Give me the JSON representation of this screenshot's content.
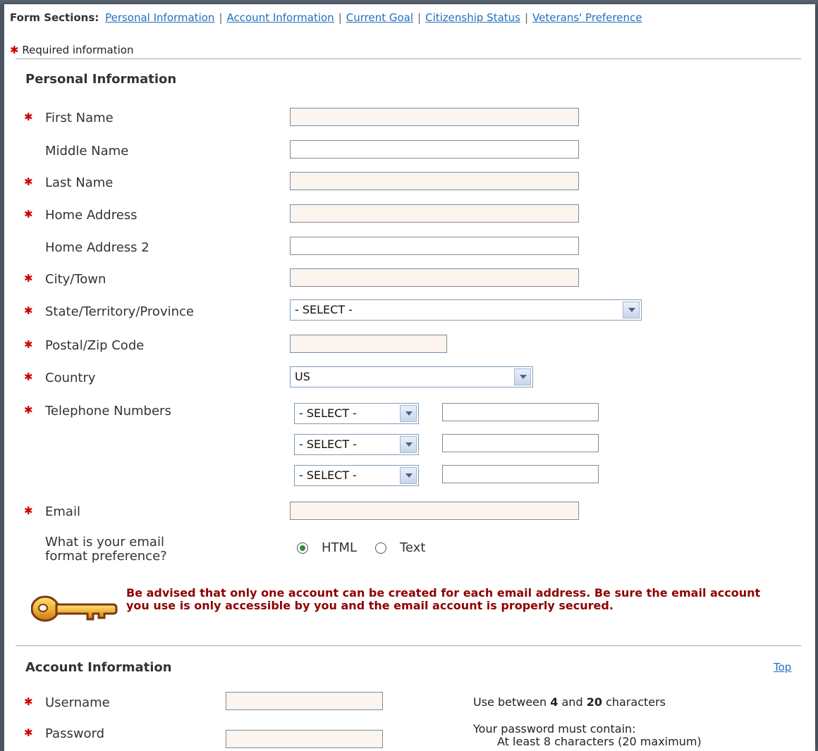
{
  "nav": {
    "label": "Form Sections:",
    "links": [
      "Personal Information",
      "Account Information",
      "Current Goal",
      "Citizenship Status",
      "Veterans' Preference"
    ]
  },
  "required_note": "Required information",
  "personal": {
    "title": "Personal Information",
    "first_name": "First Name",
    "middle_name": "Middle Name",
    "last_name": "Last Name",
    "home_address": "Home Address",
    "home_address2": "Home Address 2",
    "city": "City/Town",
    "state": "State/Territory/Province",
    "state_value": "- SELECT -",
    "postal": "Postal/Zip Code",
    "country": "Country",
    "country_value": "US",
    "telephone": "Telephone Numbers",
    "phone_type_value": "- SELECT -",
    "email": "Email",
    "email_pref_q1": "What is your email",
    "email_pref_q2": "format preference?",
    "opt_html": "HTML",
    "opt_text": "Text",
    "warning": "Be advised that only one account can be created for each email address. Be sure the email account you use is only accessible by you and the email account is properly secured."
  },
  "account": {
    "title": "Account Information",
    "top_link": "Top",
    "username": "Username",
    "password": "Password",
    "username_hint_pre": "Use between",
    "username_hint_min": "4",
    "username_hint_and": "and",
    "username_hint_max": "20",
    "username_hint_post": "characters",
    "password_hint": "Your password must contain:",
    "password_hint2": "At least 8 characters (20 maximum)"
  },
  "colors": {
    "asterisk": "#d10000",
    "link": "#1f6fbf",
    "warning": "#8e0000",
    "required_field_bg": "#fcf4ef"
  }
}
